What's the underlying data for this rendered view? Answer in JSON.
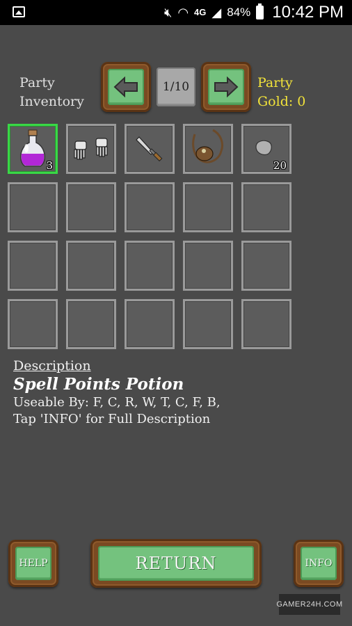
{
  "status_bar": {
    "battery": "84%",
    "time": "10:42 PM",
    "network": "4G"
  },
  "header": {
    "party_inventory_line1": "Party",
    "party_inventory_line2": "Inventory",
    "page_indicator": "1/10",
    "gold_line1": "Party",
    "gold_line2": "Gold: 0"
  },
  "inventory": {
    "slots": [
      {
        "icon": "potion-icon",
        "count": "3",
        "selected": true
      },
      {
        "icon": "gauntlets-icon",
        "count": ""
      },
      {
        "icon": "dagger-icon",
        "count": ""
      },
      {
        "icon": "sling-icon",
        "count": ""
      },
      {
        "icon": "stone-icon",
        "count": "20"
      }
    ]
  },
  "description": {
    "heading": "Description",
    "title": "Spell Points Potion",
    "line1": "Useable By: F, C, R, W, T, C, F, B,",
    "line2": "Tap 'INFO' for Full Description"
  },
  "buttons": {
    "help": "HELP",
    "return": "RETURN",
    "info": "INFO"
  },
  "watermark": "GAMER24H.COM",
  "colors": {
    "background": "#4a4a4a",
    "gold_text": "#f2e33a",
    "selected_border": "#39d846",
    "button_green": "#74c27e",
    "wood": "#7a4a22"
  }
}
